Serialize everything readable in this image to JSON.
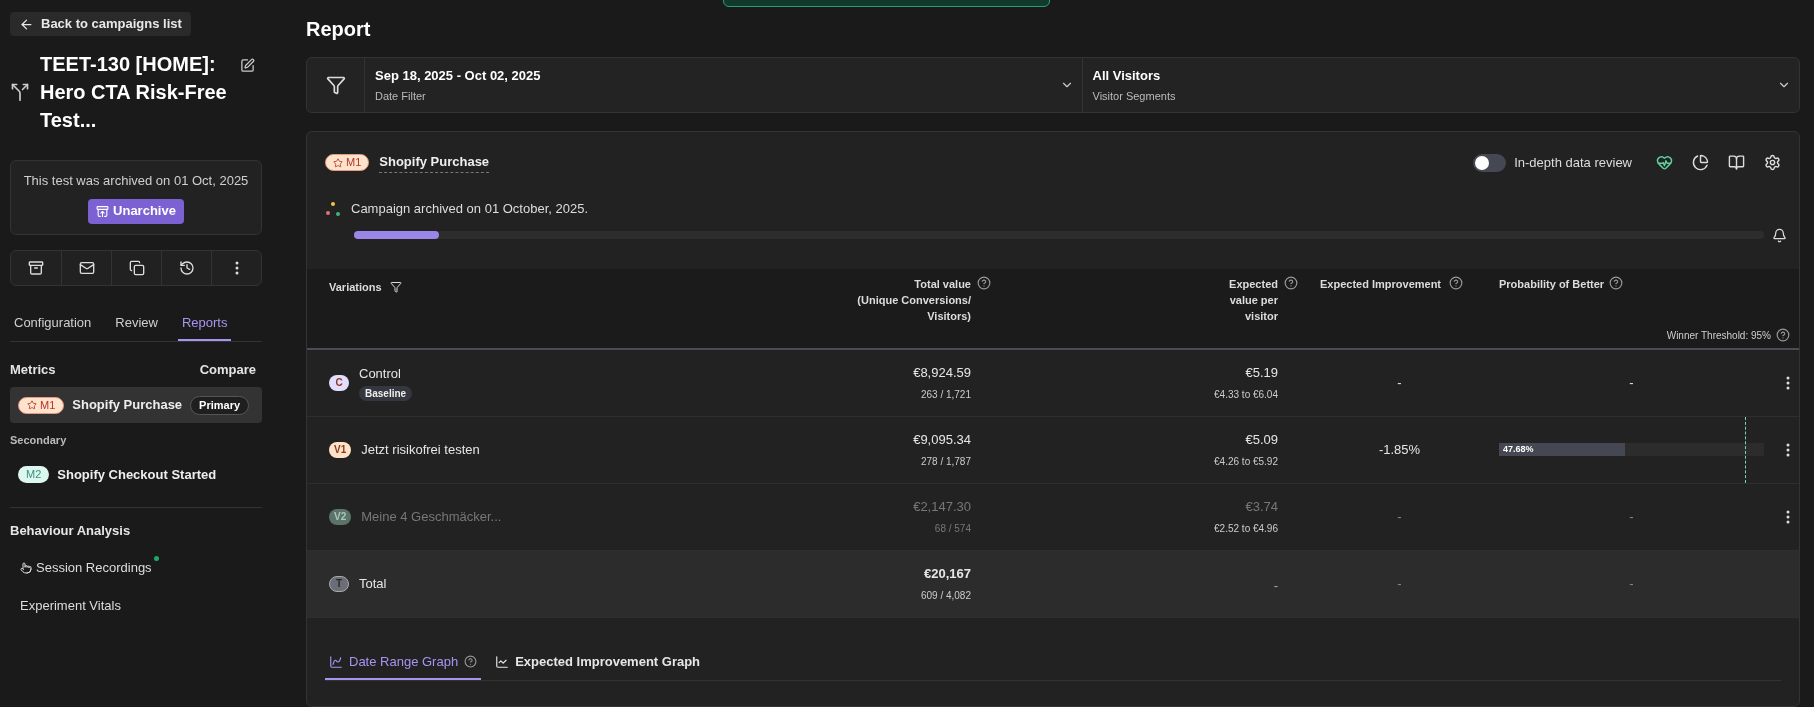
{
  "sidebar": {
    "back_button": "Back to campaigns list",
    "title": "TEET-130 [HOME]: Hero CTA Risk-Free Test...",
    "archive_notice": {
      "text": "This test was archived on 01 Oct, 2025",
      "button": "Unarchive"
    },
    "tabs": [
      {
        "label": "Configuration",
        "selected": false
      },
      {
        "label": "Review",
        "selected": false
      },
      {
        "label": "Reports",
        "selected": true
      }
    ],
    "metrics": {
      "heading": "Metrics",
      "compare": "Compare",
      "secondary_heading": "Secondary",
      "primary": [
        {
          "badge": "M1",
          "name": "Shopify Purchase",
          "tag": "Primary",
          "selected": true,
          "color": "#ffe3cc"
        }
      ],
      "secondary": [
        {
          "badge": "M2",
          "name": "Shopify Checkout Started",
          "selected": false,
          "color": "#dcf7ee"
        }
      ]
    },
    "behaviour": {
      "heading": "Behaviour Analysis",
      "items": [
        {
          "label": "Session Recordings",
          "kind": "recordings",
          "new": true
        },
        {
          "label": "Experiment Vitals",
          "kind": "plain",
          "new": false
        }
      ]
    }
  },
  "report": {
    "title": "Report",
    "filters": [
      {
        "value": "Sep 18, 2025 - Oct 02, 2025",
        "label": "Date Filter"
      },
      {
        "value": "All Visitors",
        "label": "Visitor Segments"
      }
    ],
    "card": {
      "metric_badge": "M1",
      "metric_name": "Shopify Purchase",
      "toggle": {
        "label": "In-depth data review",
        "on": false
      },
      "status": {
        "text": "Campaign archived on 01 October, 2025.",
        "level": 0.06
      },
      "table": {
        "columns": [
          "Variations",
          "Total value\n(Unique Conversions/\nVisitors)",
          "Expected\nvalue per\nvisitor",
          "Expected Improvement",
          "Probability of Better"
        ],
        "winner_threshold": {
          "text": "Winner Threshold: 95%",
          "level": 0.93
        },
        "rows": [
          {
            "kind": "variation",
            "badge": "C",
            "color": "#e4defe",
            "name": "Control",
            "tag": "Baseline",
            "dimmed": false,
            "total": "€8,924.59",
            "counts": "263 / 1,721",
            "value": "€5.19",
            "range": "€4.33 to €6.04",
            "improvement": "-",
            "probability": {
              "kind": "text",
              "text": "-"
            }
          },
          {
            "kind": "variation",
            "badge": "V1",
            "color": "#ffe2c7",
            "name": "Jetzt risikofrei testen",
            "dimmed": false,
            "total": "€9,095.34",
            "counts": "278 / 1,787",
            "value": "€5.09",
            "range": "€4.26 to €5.92",
            "improvement": "-1.85%",
            "probability": {
              "kind": "bar",
              "text": "47.68%",
              "level": 0.4768
            }
          },
          {
            "kind": "variation",
            "badge": "V2",
            "color": "#5d7268",
            "name": "Meine 4 Geschmäcker...",
            "dimmed": true,
            "total": "€2,147.30",
            "counts": "68 / 574",
            "value": "€3.74",
            "range": "€2.52 to €4.96",
            "improvement": "-",
            "probability": {
              "kind": "text",
              "text": "-"
            }
          },
          {
            "kind": "total",
            "badge": "T",
            "color": "#6b6e76",
            "name": "Total",
            "dimmed": false,
            "total": "€20,167",
            "counts": "609 / 4,082",
            "value": "-",
            "improvement": "-",
            "probability": {
              "kind": "text",
              "text": "-"
            }
          }
        ]
      },
      "graph_tabs": [
        {
          "label": "Date Range Graph",
          "selected": true,
          "kind": "date"
        },
        {
          "label": "Expected Improvement Graph",
          "selected": false,
          "kind": "improvement"
        }
      ]
    }
  }
}
